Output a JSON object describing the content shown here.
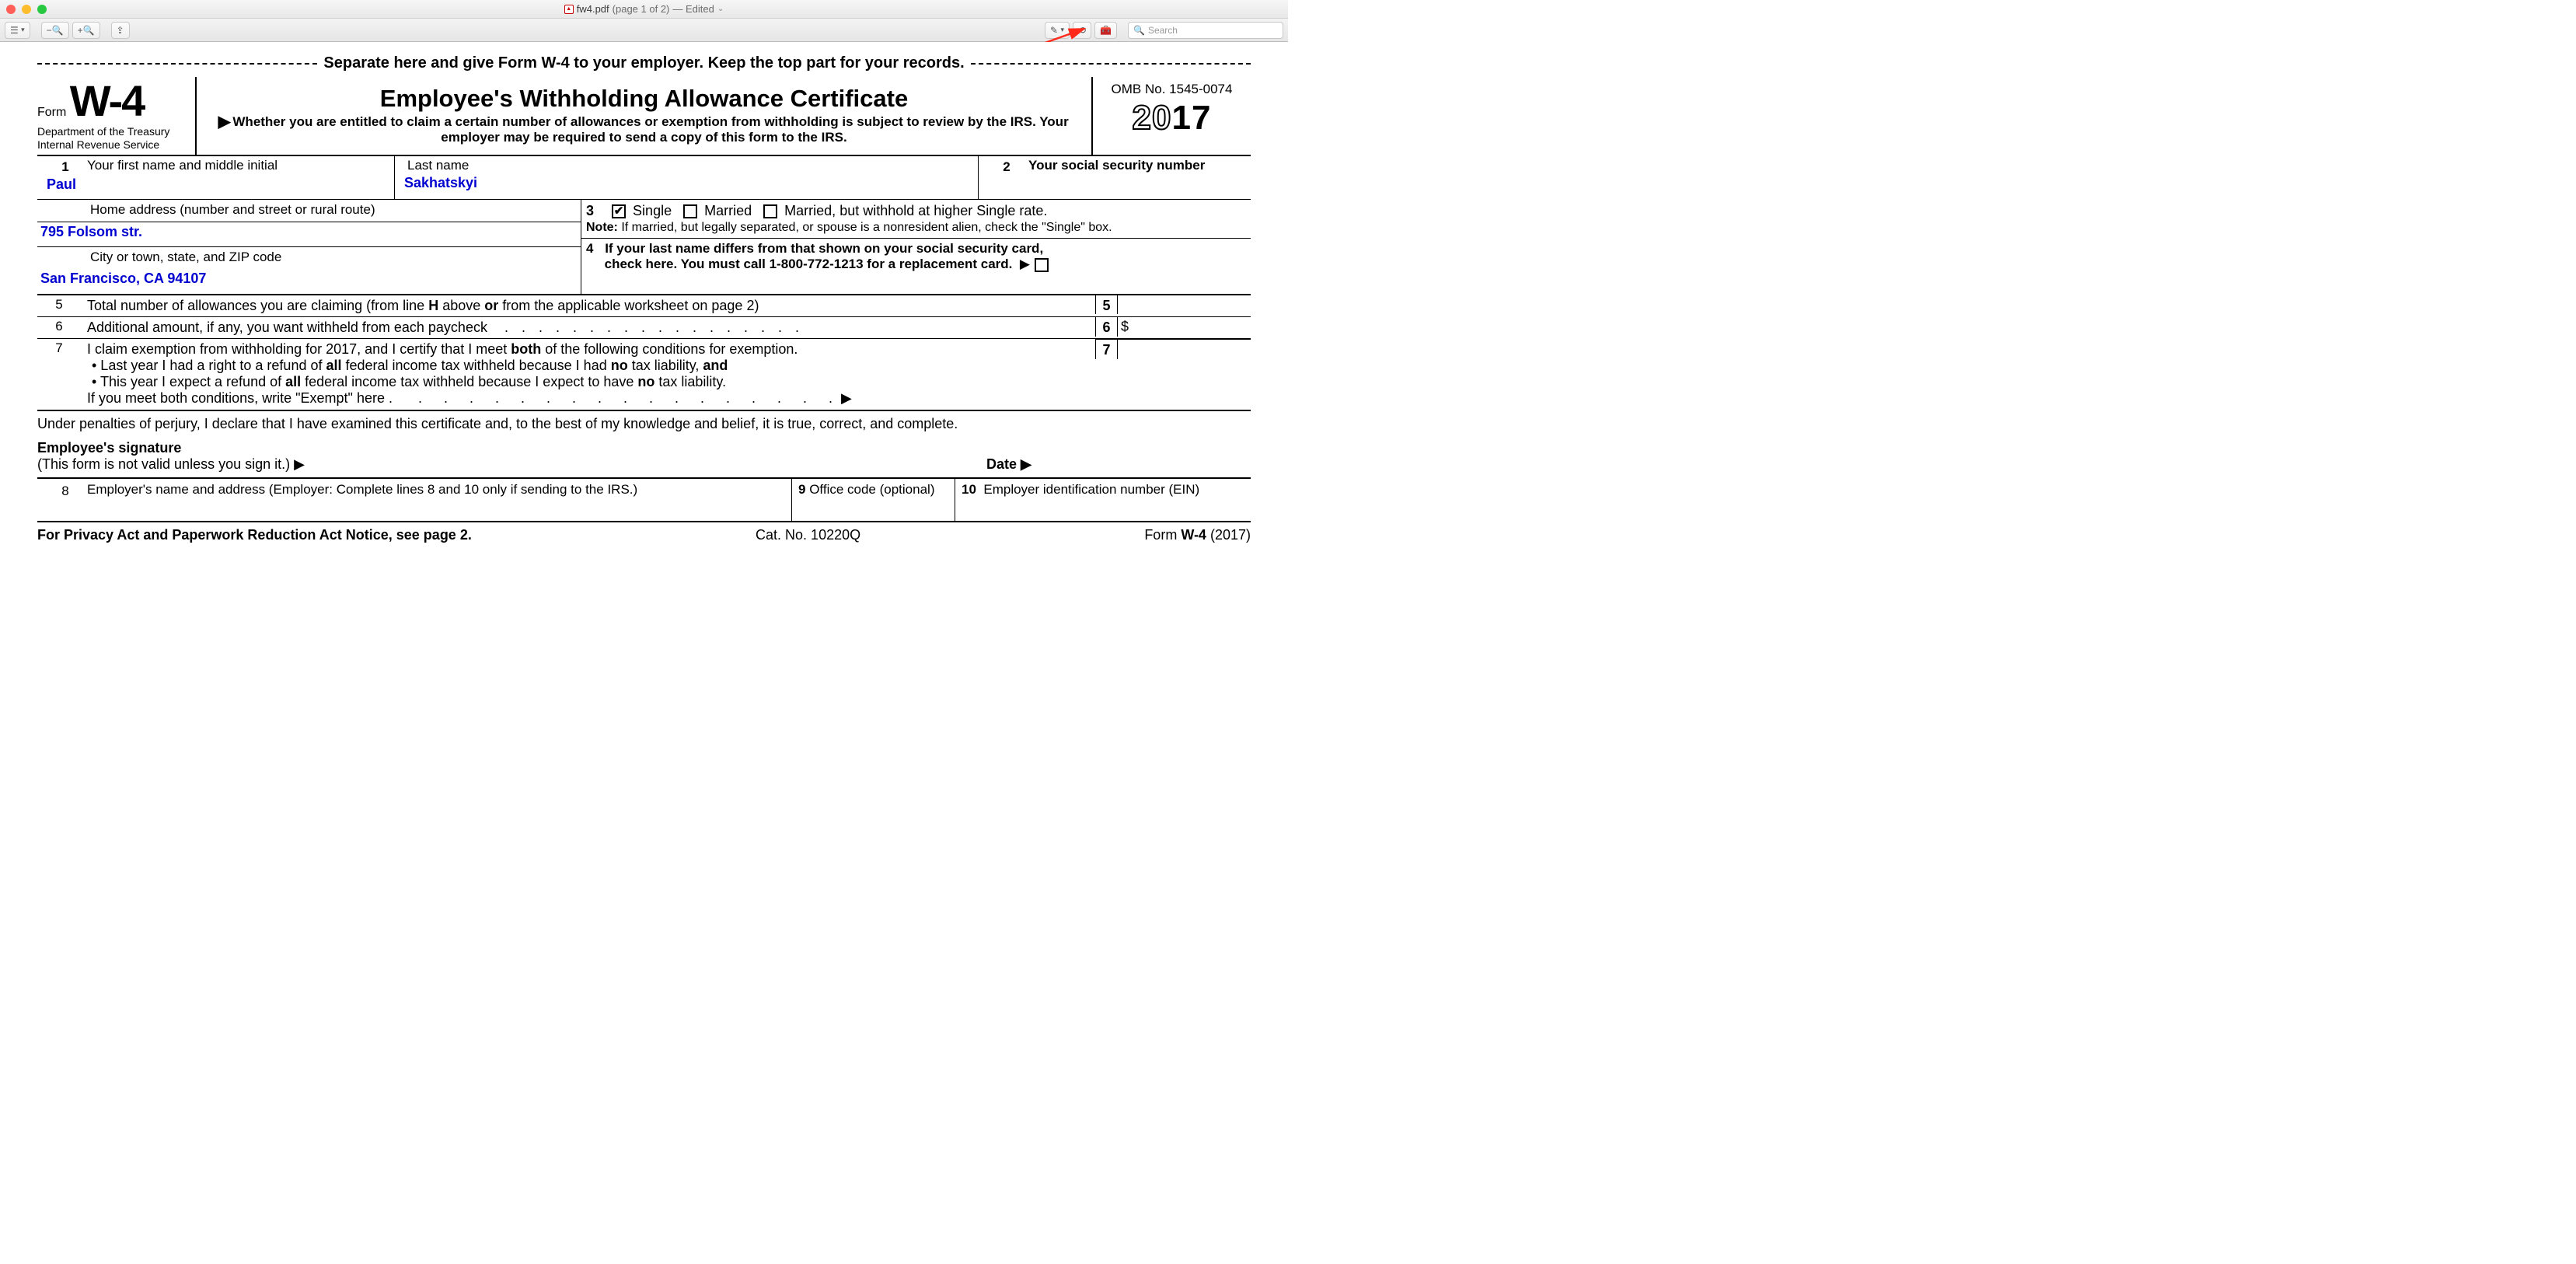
{
  "window": {
    "filename": "fw4.pdf",
    "page_info": "(page 1 of 2)",
    "status": "— Edited",
    "search_placeholder": "Search"
  },
  "separator_text": "Separate here and give Form W-4 to your employer. Keep the top part for your records.",
  "header": {
    "form_word": "Form",
    "form_code": "W-4",
    "dept1": "Department of the Treasury",
    "dept2": "Internal Revenue Service",
    "title": "Employee's Withholding Allowance Certificate",
    "subtitle": "Whether you are entitled to claim a certain number of allowances or exemption from withholding is subject to review by the IRS. Your employer may be required to send a copy of this form to the IRS.",
    "omb": "OMB No. 1545-0074",
    "year_outline": "20",
    "year_bold": "17"
  },
  "row1": {
    "num": "1",
    "first_label": "Your first name and middle initial",
    "first_value": "Paul",
    "last_label": "Last name",
    "last_value": "Sakhatskyi",
    "ssn_num": "2",
    "ssn_label": "Your social security number"
  },
  "address": {
    "home_label": "Home address (number and street or rural route)",
    "home_value": "795 Folsom str.",
    "city_label": "City or town, state, and ZIP code",
    "city_value": "San Francisco, CA 94107"
  },
  "status": {
    "num": "3",
    "single": "Single",
    "married": "Married",
    "married_higher": "Married, but withhold at higher Single rate.",
    "note_label": "Note:",
    "note_text": " If married, but legally separated, or spouse is a nonresident alien, check the \"Single\" box."
  },
  "line4": {
    "num": "4",
    "text1": "If your last name differs from that shown on your social security card,",
    "text2": "check here. You must call 1-800-772-1213 for a replacement card."
  },
  "line5": {
    "num": "5",
    "text_a": "Total number of allowances you are claiming (from line ",
    "text_b": "H",
    "text_c": " above ",
    "text_d": "or",
    "text_e": " from the applicable worksheet on page 2)",
    "box": "5"
  },
  "line6": {
    "num": "6",
    "text": "Additional amount, if any, you want withheld from each paycheck",
    "box": "6",
    "dollar": "$"
  },
  "line7": {
    "num": "7",
    "intro_a": "I claim exemption from withholding for 2017, and I certify that I meet ",
    "intro_b": "both",
    "intro_c": " of the following conditions for exemption.",
    "b1_a": "• Last year I had a right to a refund of ",
    "b1_b": "all",
    "b1_c": " federal income tax withheld because I had ",
    "b1_d": "no",
    "b1_e": " tax liability, ",
    "b1_f": "and",
    "b2_a": "• This year I expect a refund of ",
    "b2_b": "all",
    "b2_c": " federal income tax withheld because I expect to have ",
    "b2_d": "no",
    "b2_e": " tax liability.",
    "meet": "If you meet both conditions, write \"Exempt\" here .",
    "box": "7"
  },
  "perjury": "Under penalties of perjury, I declare that I have examined this certificate and, to the best of my knowledge and belief, it is true, correct, and complete.",
  "signature": {
    "label": "Employee's signature",
    "note": "(This form is not valid unless you sign it.)  ▶",
    "date": "Date ▶"
  },
  "row8": {
    "c8num": "8",
    "c8": "Employer's name and address (Employer: Complete lines 8 and 10 only if sending to the IRS.)",
    "c9num": "9",
    "c9": "Office code (optional)",
    "c10num": "10",
    "c10": "Employer identification number (EIN)"
  },
  "footer": {
    "left": "For Privacy Act and Paperwork Reduction Act Notice, see page 2.",
    "mid": "Cat. No. 10220Q",
    "right_a": "Form ",
    "right_b": "W-4",
    "right_c": " (2017)"
  }
}
